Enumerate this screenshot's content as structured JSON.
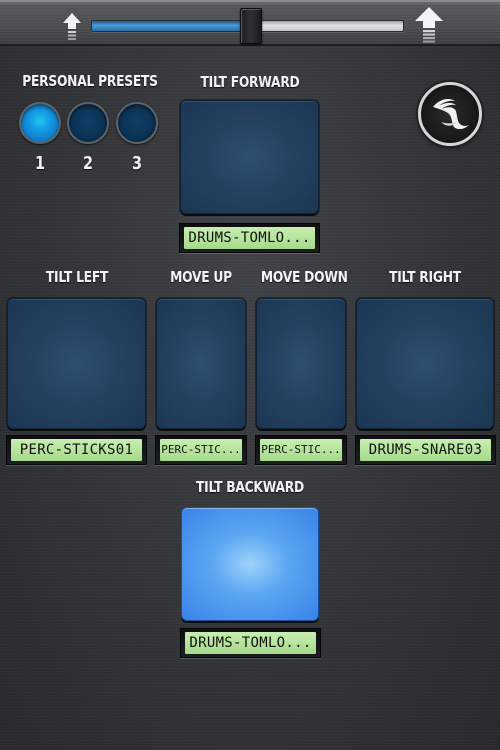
{
  "top_bar": {
    "volume_slider": {
      "value_percent": 51,
      "min_icon": "arrow-up-small-icon",
      "max_icon": "arrow-up-large-icon"
    }
  },
  "presets": {
    "title": "PERSONAL PRESETS",
    "items": [
      {
        "label": "1",
        "active": true
      },
      {
        "label": "2",
        "active": false
      },
      {
        "label": "3",
        "active": false
      }
    ]
  },
  "logo": {
    "icon": "bird-logo-icon"
  },
  "pads": {
    "tilt_forward": {
      "label": "TILT FORWARD",
      "sample": "DRUMS-TOMLO...",
      "active": false
    },
    "tilt_left": {
      "label": "TILT LEFT",
      "sample": "PERC-STICKS01",
      "active": false
    },
    "move_up": {
      "label": "MOVE UP",
      "sample": "PERC-STIC...",
      "active": false
    },
    "move_down": {
      "label": "MOVE DOWN",
      "sample": "PERC-STIC...",
      "active": false
    },
    "tilt_right": {
      "label": "TILT RIGHT",
      "sample": "DRUMS-SNARE03",
      "active": false
    },
    "tilt_backward": {
      "label": "TILT BACKWARD",
      "sample": "DRUMS-TOMLO...",
      "active": true
    }
  },
  "colors": {
    "accent_blue": "#1496e2",
    "pad_idle": "#244260",
    "pad_active": "#5aa6f2",
    "lcd_green": "#b3e39a"
  }
}
